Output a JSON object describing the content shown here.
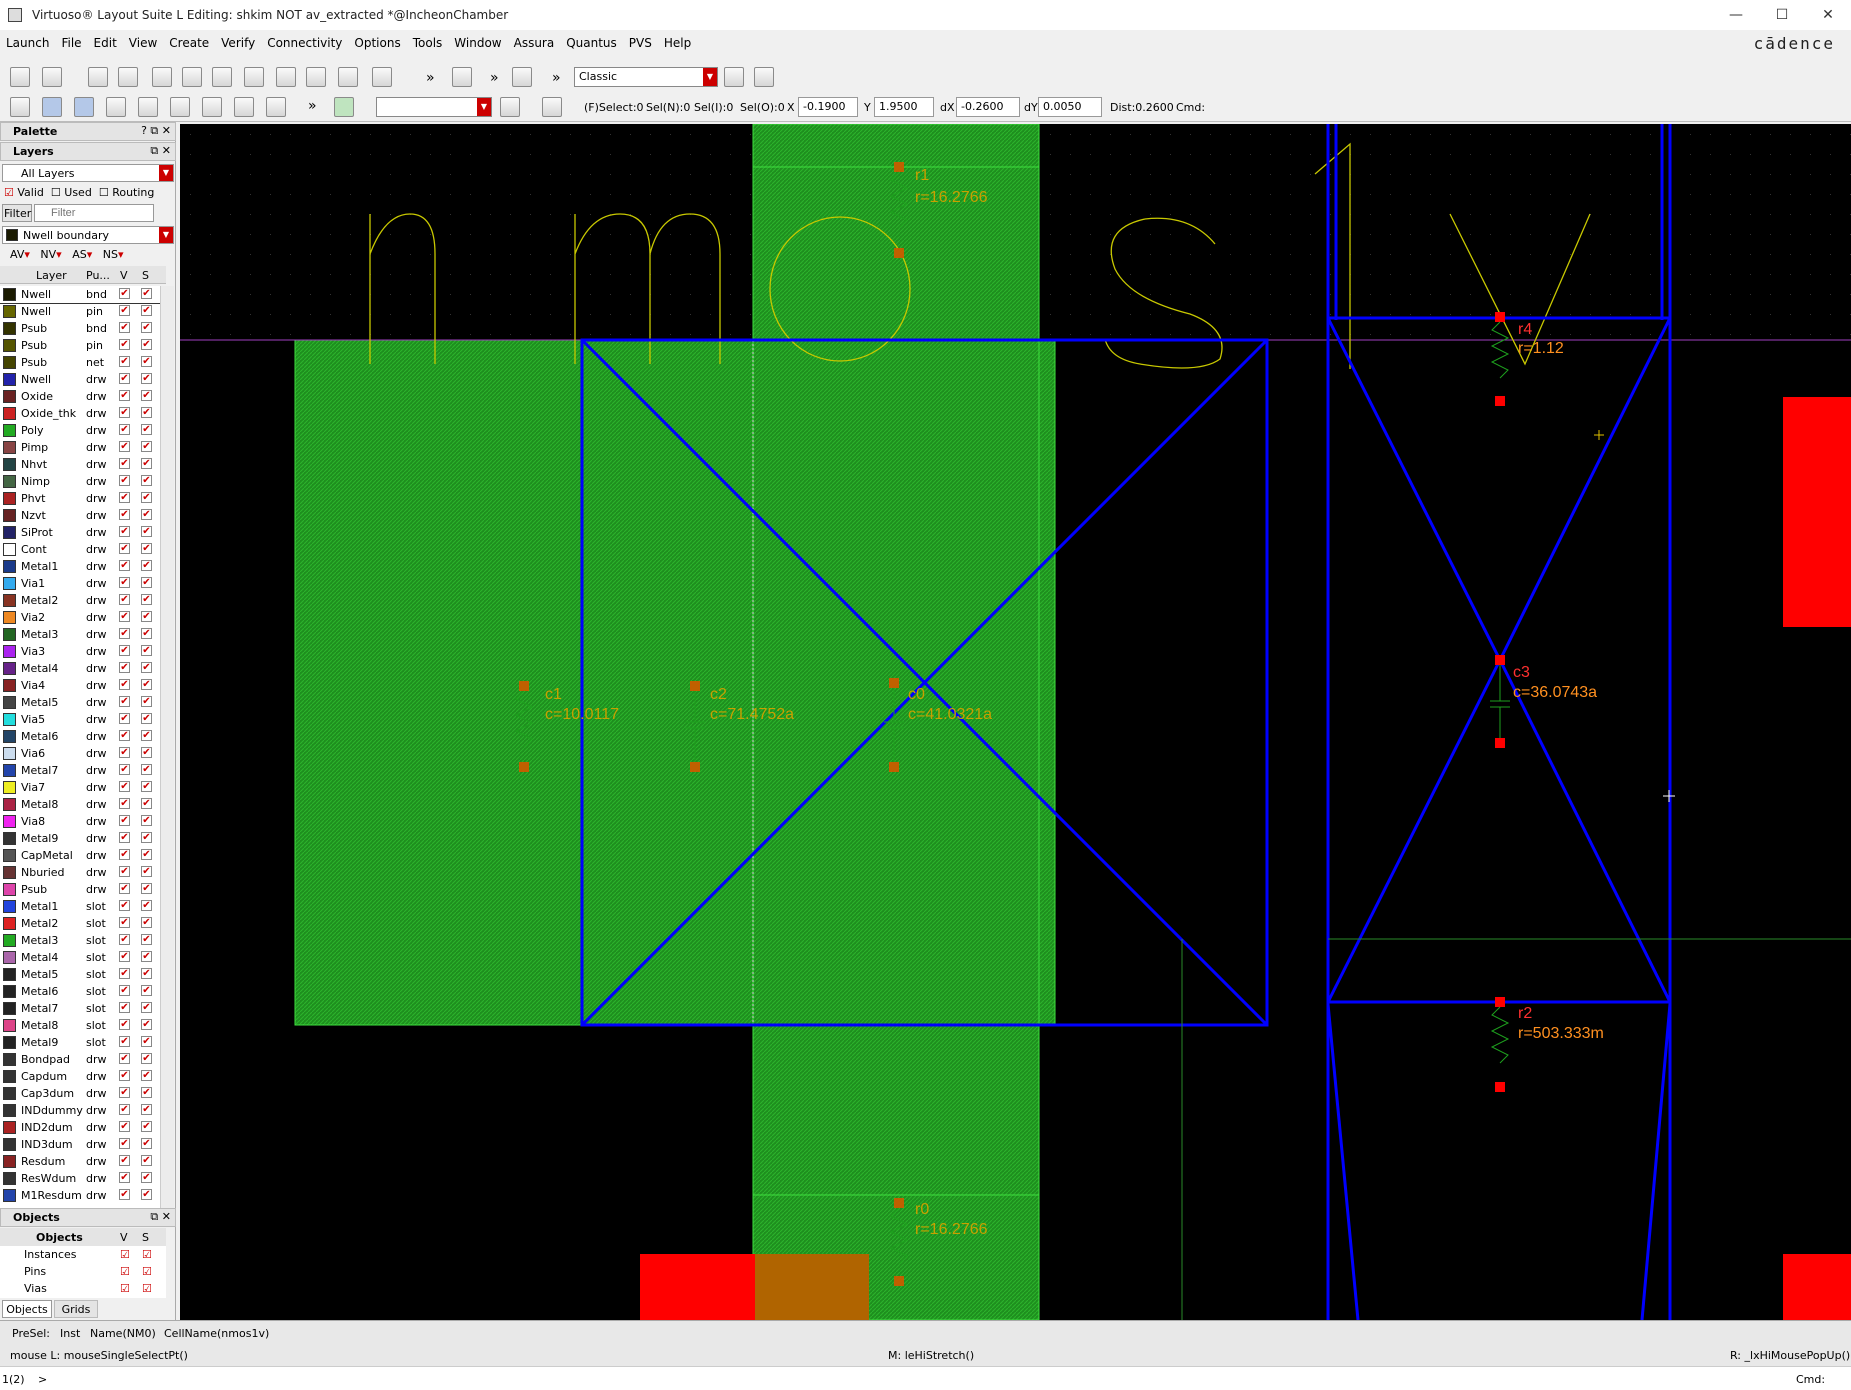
{
  "window": {
    "title": "Virtuoso® Layout Suite L Editing: shkim NOT av_extracted *@IncheonChamber",
    "min": "—",
    "max": "☐",
    "close": "✕"
  },
  "menu": [
    "Launch",
    "File",
    "Edit",
    "View",
    "Create",
    "Verify",
    "Connectivity",
    "Options",
    "Tools",
    "Window",
    "Assura",
    "Quantus",
    "PVS",
    "Help"
  ],
  "brand": "cādence",
  "toolbar": {
    "workspace": "Classic",
    "more": "»"
  },
  "coords": {
    "fselect": "(F)Select:0",
    "seln": "Sel(N):0",
    "seli": "Sel(I):0",
    "selo": "Sel(O):0",
    "x_label": "X",
    "x_value": "-0.1900",
    "y_label": "Y",
    "y_value": "1.9500",
    "dx_label": "dX",
    "dx_value": "-0.2600",
    "dy_label": "dY",
    "dy_value": "0.0050",
    "dist": "Dist:0.2600",
    "cmd": "Cmd:"
  },
  "palette": {
    "title": "Palette",
    "layers_title": "Layers",
    "filter_all": "All Layers",
    "valid": "Valid",
    "used": "Used",
    "routing": "Routing",
    "filter_btn": "Filter",
    "filter_placeholder": "Filter",
    "current_layer": "Nwell boundary",
    "av": "AV",
    "nv": "NV",
    "as": "AS",
    "ns": "NS",
    "col_layer": "Layer",
    "col_pu": "Pu...",
    "col_v": "V",
    "col_s": "S",
    "layers": [
      {
        "n": "Nwell",
        "p": "bnd",
        "c": "#1a1a00"
      },
      {
        "n": "Nwell",
        "p": "pin",
        "c": "#666600"
      },
      {
        "n": "Psub",
        "p": "bnd",
        "c": "#333300"
      },
      {
        "n": "Psub",
        "p": "pin",
        "c": "#555500"
      },
      {
        "n": "Psub",
        "p": "net",
        "c": "#444400"
      },
      {
        "n": "Nwell",
        "p": "drw",
        "c": "#2222aa"
      },
      {
        "n": "Oxide",
        "p": "drw",
        "c": "#6a2222"
      },
      {
        "n": "Oxide_thk",
        "p": "drw",
        "c": "#cc2222"
      },
      {
        "n": "Poly",
        "p": "drw",
        "c": "#22aa22"
      },
      {
        "n": "Pimp",
        "p": "drw",
        "c": "#884444"
      },
      {
        "n": "Nhvt",
        "p": "drw",
        "c": "#224444"
      },
      {
        "n": "Nimp",
        "p": "drw",
        "c": "#446644"
      },
      {
        "n": "Phvt",
        "p": "drw",
        "c": "#aa2222"
      },
      {
        "n": "Nzvt",
        "p": "drw",
        "c": "#662222"
      },
      {
        "n": "SiProt",
        "p": "drw",
        "c": "#222266"
      },
      {
        "n": "Cont",
        "p": "drw",
        "c": "#ffffff"
      },
      {
        "n": "Metal1",
        "p": "drw",
        "c": "#1a3a8a"
      },
      {
        "n": "Via1",
        "p": "drw",
        "c": "#33aaee"
      },
      {
        "n": "Metal2",
        "p": "drw",
        "c": "#883322"
      },
      {
        "n": "Via2",
        "p": "drw",
        "c": "#ee8822"
      },
      {
        "n": "Metal3",
        "p": "drw",
        "c": "#226622"
      },
      {
        "n": "Via3",
        "p": "drw",
        "c": "#aa22ee"
      },
      {
        "n": "Metal4",
        "p": "drw",
        "c": "#662288"
      },
      {
        "n": "Via4",
        "p": "drw",
        "c": "#882222"
      },
      {
        "n": "Metal5",
        "p": "drw",
        "c": "#444444"
      },
      {
        "n": "Via5",
        "p": "drw",
        "c": "#22dddd"
      },
      {
        "n": "Metal6",
        "p": "drw",
        "c": "#224466"
      },
      {
        "n": "Via6",
        "p": "drw",
        "c": "#ccddee"
      },
      {
        "n": "Metal7",
        "p": "drw",
        "c": "#2244aa"
      },
      {
        "n": "Via7",
        "p": "drw",
        "c": "#eeee22"
      },
      {
        "n": "Metal8",
        "p": "drw",
        "c": "#aa2244"
      },
      {
        "n": "Via8",
        "p": "drw",
        "c": "#ee22ee"
      },
      {
        "n": "Metal9",
        "p": "drw",
        "c": "#333333"
      },
      {
        "n": "CapMetal",
        "p": "drw",
        "c": "#555555"
      },
      {
        "n": "Nburied",
        "p": "drw",
        "c": "#663333"
      },
      {
        "n": "Psub",
        "p": "drw",
        "c": "#dd44aa"
      },
      {
        "n": "Metal1",
        "p": "slot",
        "c": "#2244dd"
      },
      {
        "n": "Metal2",
        "p": "slot",
        "c": "#dd2222"
      },
      {
        "n": "Metal3",
        "p": "slot",
        "c": "#22aa22"
      },
      {
        "n": "Metal4",
        "p": "slot",
        "c": "#aa66aa"
      },
      {
        "n": "Metal5",
        "p": "slot",
        "c": "#222222"
      },
      {
        "n": "Metal6",
        "p": "slot",
        "c": "#222222"
      },
      {
        "n": "Metal7",
        "p": "slot",
        "c": "#222222"
      },
      {
        "n": "Metal8",
        "p": "slot",
        "c": "#dd4488"
      },
      {
        "n": "Metal9",
        "p": "slot",
        "c": "#222222"
      },
      {
        "n": "Bondpad",
        "p": "drw",
        "c": "#333333"
      },
      {
        "n": "Capdum",
        "p": "drw",
        "c": "#333333"
      },
      {
        "n": "Cap3dum",
        "p": "drw",
        "c": "#333333"
      },
      {
        "n": "INDdummy",
        "p": "drw",
        "c": "#333333"
      },
      {
        "n": "IND2dum",
        "p": "drw",
        "c": "#aa2222"
      },
      {
        "n": "IND3dum",
        "p": "drw",
        "c": "#333333"
      },
      {
        "n": "Resdum",
        "p": "drw",
        "c": "#882222"
      },
      {
        "n": "ResWdum",
        "p": "drw",
        "c": "#333333"
      },
      {
        "n": "M1Resdum",
        "p": "drw",
        "c": "#2244aa"
      }
    ]
  },
  "objects": {
    "title": "Objects",
    "col": "Objects",
    "v": "V",
    "s": "S",
    "items": [
      "Instances",
      "Pins",
      "Vias"
    ],
    "tab_objects": "Objects",
    "tab_grids": "Grids"
  },
  "canvas": {
    "label_text": "nmos1v",
    "r1": "r1",
    "r1v": "r=16.2766",
    "r0": "r0",
    "r0v": "r=16.2766",
    "c1": "c1",
    "c1v": "c=10.0117",
    "c2": "c2",
    "c2v": "c=71.4752a",
    "c0": "c0",
    "c0v": "c=41.0321a",
    "r4": "r4",
    "r4v": "r=1.12",
    "c3": "c3",
    "c3v": "c=36.0743a",
    "r2": "r2",
    "r2v": "r=503.333m"
  },
  "status": {
    "presel": "PreSel:",
    "inst": "Inst",
    "name": "Name(NM0)",
    "cell": "CellName(nmos1v)",
    "mouse_l": "mouse L: mouseSingleSelectPt()",
    "mouse_m": "M: leHiStretch()",
    "mouse_r": "R: _lxHiMousePopUp()",
    "line": "1(2)",
    "prompt": ">",
    "cmd": "Cmd:"
  },
  "colors": {
    "green": "#1a8c1a",
    "blue": "#0000ff",
    "red": "#ff0000",
    "yellow": "#c8c800",
    "orange": "#e07000"
  }
}
